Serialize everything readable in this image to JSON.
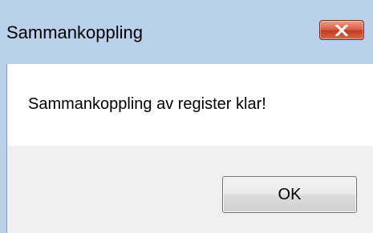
{
  "dialog": {
    "title": "Sammankoppling",
    "message": "Sammankoppling av register klar!",
    "ok_label": "OK",
    "close_icon": "close-icon"
  },
  "colors": {
    "titlebar": "#b9d1ea",
    "close_button": "#c9472e",
    "content_background": "#ffffff",
    "footer_background": "#f0f0f0"
  }
}
